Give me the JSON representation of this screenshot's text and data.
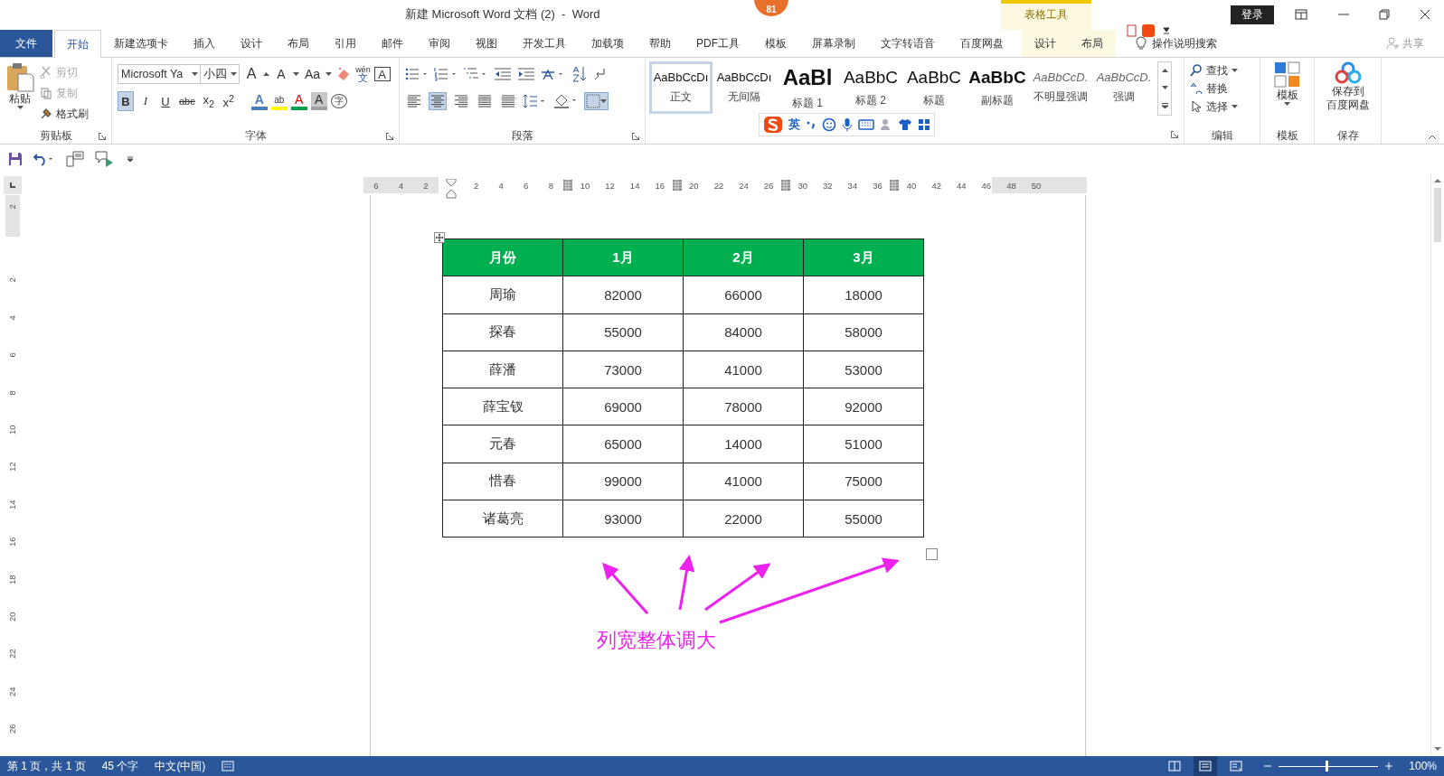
{
  "window": {
    "title": "新建 Microsoft Word 文档 (2)  -  Word",
    "context_title": "表格工具",
    "login": "登录",
    "badge": "81"
  },
  "tabs": [
    {
      "label": "文件",
      "kind": "file",
      "selected": false
    },
    {
      "label": "开始",
      "kind": "normal",
      "selected": true
    },
    {
      "label": "新建选项卡",
      "kind": "normal",
      "selected": false
    },
    {
      "label": "插入",
      "kind": "normal",
      "selected": false
    },
    {
      "label": "设计",
      "kind": "normal",
      "selected": false
    },
    {
      "label": "布局",
      "kind": "normal",
      "selected": false
    },
    {
      "label": "引用",
      "kind": "normal",
      "selected": false
    },
    {
      "label": "邮件",
      "kind": "normal",
      "selected": false
    },
    {
      "label": "审阅",
      "kind": "normal",
      "selected": false
    },
    {
      "label": "视图",
      "kind": "normal",
      "selected": false
    },
    {
      "label": "开发工具",
      "kind": "normal",
      "selected": false
    },
    {
      "label": "加载项",
      "kind": "normal",
      "selected": false
    },
    {
      "label": "帮助",
      "kind": "normal",
      "selected": false
    },
    {
      "label": "PDF工具",
      "kind": "normal",
      "selected": false
    },
    {
      "label": "模板",
      "kind": "normal",
      "selected": false
    },
    {
      "label": "屏幕录制",
      "kind": "normal",
      "selected": false
    },
    {
      "label": "文字转语音",
      "kind": "normal",
      "selected": false
    },
    {
      "label": "百度网盘",
      "kind": "normal",
      "selected": false
    },
    {
      "label": "设计",
      "kind": "context",
      "selected": false
    },
    {
      "label": "布局",
      "kind": "context",
      "selected": false
    }
  ],
  "tell_me": "操作说明搜索",
  "share": "共享",
  "clipboard": {
    "paste": "粘贴",
    "group": "剪贴板",
    "items": [
      {
        "label": "剪切",
        "disabled": true
      },
      {
        "label": "复制",
        "disabled": true
      },
      {
        "label": "格式刷",
        "disabled": false
      }
    ]
  },
  "font": {
    "name": "Microsoft Ya",
    "size": "小四",
    "grow": "A",
    "shrink": "A",
    "case_button": "Aa",
    "pinyin": "wén",
    "pinyin_char": "文",
    "border_char": "A",
    "group": "字体",
    "format_buttons": [
      {
        "label": "B",
        "selected": true
      },
      {
        "label": "I",
        "selected": false
      },
      {
        "label": "U",
        "selected": false
      },
      {
        "label": "abc",
        "selected": false
      },
      {
        "label": "x$_{2}$",
        "selected": false
      },
      {
        "label": "x$^{2}$",
        "selected": false
      }
    ],
    "effect_buttons": [
      {
        "label": "A",
        "color": "#4a7ebb"
      },
      {
        "label": "ab",
        "color": "#ffff00"
      },
      {
        "label": "A",
        "color": "#00a050"
      },
      {
        "label": "A",
        "color": "#a0a0a0"
      },
      {
        "label": "字",
        "color": "#555555"
      }
    ]
  },
  "paragraph": {
    "group": "段落",
    "align": [
      {
        "selected": false
      },
      {
        "selected": true
      },
      {
        "selected": false
      },
      {
        "selected": false
      },
      {
        "selected": false
      }
    ]
  },
  "styles": [
    {
      "preview": "AaBbCcDı",
      "name": "正文",
      "kind": "normal",
      "selected": true
    },
    {
      "preview": "AaBbCcDı",
      "name": "无间隔",
      "kind": "normal",
      "selected": false
    },
    {
      "preview": "AaBl",
      "name": "标题 1",
      "kind": "h1",
      "selected": false
    },
    {
      "preview": "AaBbC",
      "name": "标题 2",
      "kind": "h2",
      "selected": false
    },
    {
      "preview": "AaBbC",
      "name": "标题",
      "kind": "h2",
      "selected": false
    },
    {
      "preview": "AaBbC",
      "name": "副标题",
      "kind": "bold",
      "selected": false
    },
    {
      "preview": "AaBbCcD.",
      "name": "不明显强调",
      "kind": "italic",
      "selected": false
    },
    {
      "preview": "AaBbCcD.",
      "name": "强调",
      "kind": "italic",
      "selected": false
    }
  ],
  "editing": {
    "find": "查找",
    "replace": "替换",
    "select": "选择",
    "group": "编辑"
  },
  "template": {
    "label": "模板",
    "group": "模板"
  },
  "baidu": {
    "lines": [
      "保存到",
      "百度网盘"
    ],
    "group": "保存"
  },
  "ime_bar": {
    "lang": "英"
  },
  "ruler": [
    {
      "kind": "num",
      "label": "6"
    },
    {
      "kind": "num",
      "label": "4"
    },
    {
      "kind": "num",
      "label": "2"
    },
    {
      "kind": "indent"
    },
    {
      "kind": "num",
      "label": "2"
    },
    {
      "kind": "num",
      "label": "4"
    },
    {
      "kind": "num",
      "label": "6"
    },
    {
      "kind": "num",
      "label": "8"
    },
    {
      "kind": "marker"
    },
    {
      "kind": "num",
      "label": "10"
    },
    {
      "kind": "num",
      "label": "12"
    },
    {
      "kind": "num",
      "label": "14"
    },
    {
      "kind": "num",
      "label": "16"
    },
    {
      "kind": "marker"
    },
    {
      "kind": "num",
      "label": "20"
    },
    {
      "kind": "num",
      "label": "22"
    },
    {
      "kind": "num",
      "label": "24"
    },
    {
      "kind": "num",
      "label": "26"
    },
    {
      "kind": "marker"
    },
    {
      "kind": "num",
      "label": "30"
    },
    {
      "kind": "num",
      "label": "32"
    },
    {
      "kind": "num",
      "label": "34"
    },
    {
      "kind": "num",
      "label": "36"
    },
    {
      "kind": "marker"
    },
    {
      "kind": "num",
      "label": "40"
    },
    {
      "kind": "num",
      "label": "42"
    },
    {
      "kind": "num",
      "label": "44"
    },
    {
      "kind": "num",
      "label": "46"
    },
    {
      "kind": "num",
      "label": "48"
    },
    {
      "kind": "num",
      "label": "50"
    }
  ],
  "vruler": [
    "2",
    "2",
    "4",
    "6",
    "8",
    "10",
    "12",
    "14",
    "16",
    "18",
    "20",
    "22",
    "24",
    "26"
  ],
  "table": {
    "columns": [
      "月份",
      "1月",
      "2月",
      "3月"
    ],
    "rows": [
      [
        "周瑜",
        "82000",
        "66000",
        "18000"
      ],
      [
        "探春",
        "55000",
        "84000",
        "58000"
      ],
      [
        "薛潘",
        "73000",
        "41000",
        "53000"
      ],
      [
        "薛宝钗",
        "69000",
        "78000",
        "92000"
      ],
      [
        "元春",
        "65000",
        "14000",
        "51000"
      ],
      [
        "惜春",
        "99000",
        "41000",
        "75000"
      ],
      [
        "诸葛亮",
        "93000",
        "22000",
        "55000"
      ]
    ]
  },
  "annotation": "列宽整体调大",
  "status_bar": {
    "items": [
      "第 1 页，共 1 页",
      "45 个字",
      "中文(中国)"
    ],
    "views": [
      {
        "selected": false
      },
      {
        "selected": true
      },
      {
        "selected": false
      }
    ],
    "zoom": {
      "level": 0.47
    },
    "zoom_text": "100%"
  }
}
